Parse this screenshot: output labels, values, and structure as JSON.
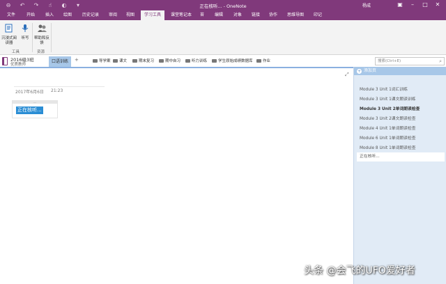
{
  "app": {
    "window_title": "正在核听... - OneNote",
    "user_name": "杨成",
    "colors": {
      "accent": "#80397b",
      "section_active": "#a7c7e8",
      "pane_bg": "#e1ebf6",
      "selection": "#2a8dd4"
    }
  },
  "quick_access": [
    "back-icon",
    "undo-icon",
    "redo-icon",
    "touch-mode-icon",
    "dock-icon",
    "customize-icon"
  ],
  "ribbon_tabs": [
    "文件",
    "开始",
    "插入",
    "绘图",
    "历史记录",
    "审阅",
    "视图",
    "学习工具",
    "课堂笔记本",
    "苔",
    "编辑",
    "对象",
    "链接",
    "协作",
    "思维导图",
    "印记"
  ],
  "active_tab_index": 7,
  "ribbon": {
    "buttons": [
      {
        "label": "沉浸式阅读器",
        "icon": "immersive-reader-icon"
      },
      {
        "label": "听写",
        "icon": "dictate-icon"
      },
      {
        "label": "帮助和反馈",
        "icon": "help-feedback-icon"
      }
    ],
    "groups": [
      "工具",
      "资源"
    ]
  },
  "notebook": {
    "name": "2016级3班",
    "subtitle": "优质教师"
  },
  "sections": {
    "active": "口语训练",
    "add_label": "+",
    "groups": [
      "导学案",
      "课文",
      "期末复习",
      "期中自习",
      "听力训练",
      "学生原始成绩数据库",
      "作业"
    ]
  },
  "search": {
    "placeholder": "搜索(Ctrl+E)"
  },
  "page": {
    "date": "2017年6月6日",
    "time": "21:23",
    "handle": "....",
    "selected_text": "正在核听..."
  },
  "pages_pane": {
    "add_label": "添加页",
    "items": [
      {
        "title": "Module 3 Unit 1词汇训练",
        "bold": false
      },
      {
        "title": "Module 3 Unit 1课文朗读训练",
        "bold": false
      },
      {
        "title": "Module 3 Unit 2单词朗读检查",
        "bold": true
      },
      {
        "title": "Module 3 Unit 2课文朗读检查",
        "bold": false
      },
      {
        "title": "Module 4 Unit 1单词朗读检查",
        "bold": false
      },
      {
        "title": "Module 6 Unit 1单词朗读检查",
        "bold": false
      },
      {
        "title": "Module 8 Unit 1单词朗读检查",
        "bold": false
      }
    ],
    "current": "正在核听..."
  },
  "watermark": "头条 @会飞的UFO爱好者"
}
